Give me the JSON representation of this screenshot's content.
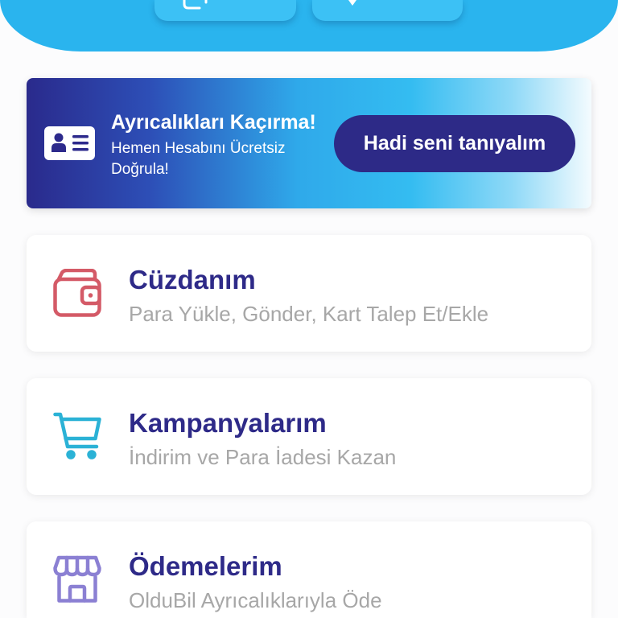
{
  "theme": {
    "page_background": "#fcfcfd",
    "header_color": "#2ab4ee",
    "top_button_color": "#3cc1f5",
    "banner_gradient_1": "#2a2a8c",
    "banner_gradient_2": "#2d4fb7",
    "banner_gradient_3": "#2fa9ea",
    "banner_gradient_4": "#34bcf1",
    "banner_gradient_5": "#8fd9f7",
    "banner_gradient_6": "#f4fbfe",
    "banner_icon_color": "#2d2a8c",
    "banner_button_color": "#2d2a87",
    "title_color": "#2e2a88",
    "subtitle_color": "#a7a7a7"
  },
  "header": {
    "actions": [
      {
        "icon": "phone-icon"
      },
      {
        "icon": "location-pin-icon"
      }
    ]
  },
  "banner": {
    "icon": "id-card-icon",
    "title": "Ayrıcalıkları Kaçırma!",
    "subtitle": "Hemen Hesabını Ücretsiz Doğrula!",
    "button_label": "Hadi seni tanıyalım"
  },
  "menu": {
    "items": [
      {
        "title": "Cüzdanım",
        "subtitle": "Para Yükle, Gönder, Kart Talep Et/Ekle",
        "icon": "wallet-icon",
        "icon_color": "#d45a67"
      },
      {
        "title": "Kampanyalarım",
        "subtitle": "İndirim ve Para İadesi Kazan",
        "icon": "shopping-cart-icon",
        "icon_color": "#2bb2d6"
      },
      {
        "title": "Ödemelerim",
        "subtitle": "OlduBil Ayrıcalıklarıyla Öde",
        "icon": "store-icon",
        "icon_color": "#8b80d3"
      }
    ]
  }
}
